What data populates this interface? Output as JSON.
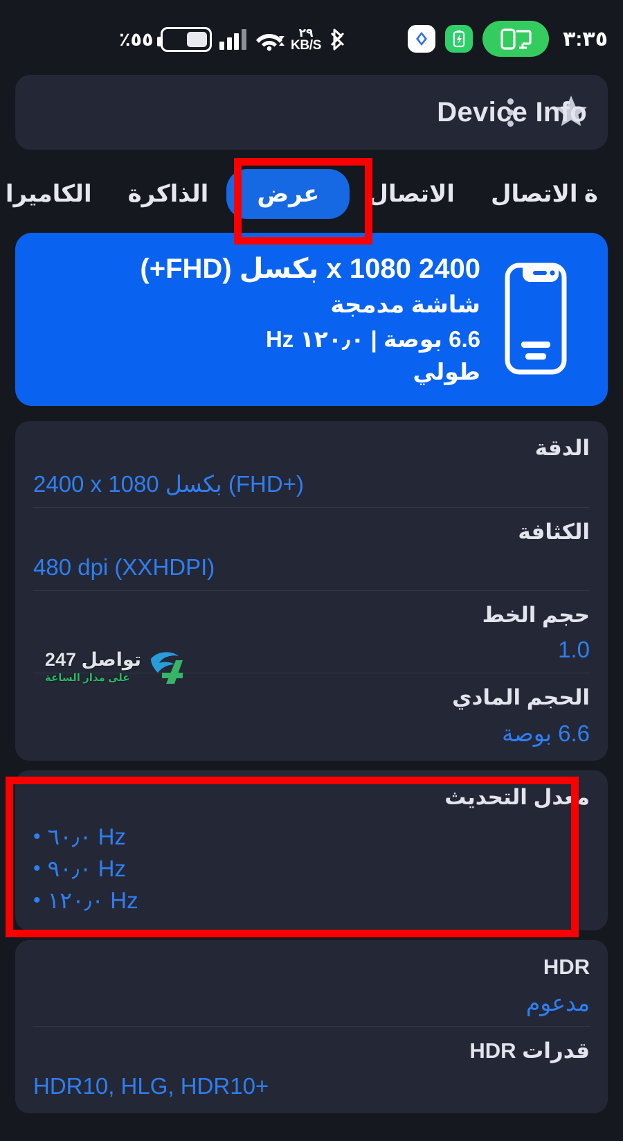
{
  "statusbar": {
    "battery_percent": "٪٥٥",
    "network_speed_value": "٢٩",
    "network_speed_unit": "KB/S",
    "time": "٣:٣٥",
    "icons": {
      "battery": "battery-icon",
      "signal": "cellular-signal-icon",
      "wifi": "wifi-icon",
      "bluetooth": "bluetooth-icon",
      "app_badge": "app-badge-icon",
      "battery_saver": "battery-saver-icon",
      "cast": "cast-screen-icon"
    }
  },
  "appbar": {
    "title": "Device Info",
    "menu_icon": "kebab-menu-icon",
    "favorite_icon": "star-icon"
  },
  "tabs": [
    {
      "label": "ة الاتصال",
      "active": false
    },
    {
      "label": "الاتصال",
      "active": false
    },
    {
      "label": "عرض",
      "active": true
    },
    {
      "label": "الذاكرة",
      "active": false
    },
    {
      "label": "الكاميرا",
      "active": false
    }
  ],
  "hero": {
    "resolution": "2400 x 1080 بكسل (FHD+)",
    "type": "شاشة مدمجة",
    "size_rate": "6.6 بوصة | ١٢٠٫٠ Hz",
    "orientation": "طولي",
    "icon": "smartphone-icon"
  },
  "details": [
    {
      "label": "الدقة",
      "value": "2400 x 1080 بكسل (FHD+)"
    },
    {
      "label": "الكثافة",
      "value": "480 dpi (XXHDPI)"
    },
    {
      "label": "حجم الخط",
      "value": "1.0"
    },
    {
      "label": "الحجم المادي",
      "value": "6.6 بوصة"
    }
  ],
  "refresh_rate": {
    "label": "معدل التحديث",
    "values": [
      "٦٠٫٠ Hz",
      "٩٠٫٠ Hz",
      "١٢٠٫٠ Hz"
    ]
  },
  "hdr": [
    {
      "label": "HDR",
      "value": "مدعوم"
    },
    {
      "label": "قدرات HDR",
      "value": "HDR10, HLG, HDR10+"
    }
  ],
  "watermark": {
    "main": "تواصل 247",
    "sub": "على مدار الساعة"
  },
  "colors": {
    "accent_blue": "#0a63f0",
    "tab_active_blue": "#1668e3",
    "value_blue": "#2f7ef2",
    "card_bg": "#242836",
    "page_bg": "#16181f",
    "annotation_red": "#fb0000",
    "cast_green": "#35cc5f"
  }
}
